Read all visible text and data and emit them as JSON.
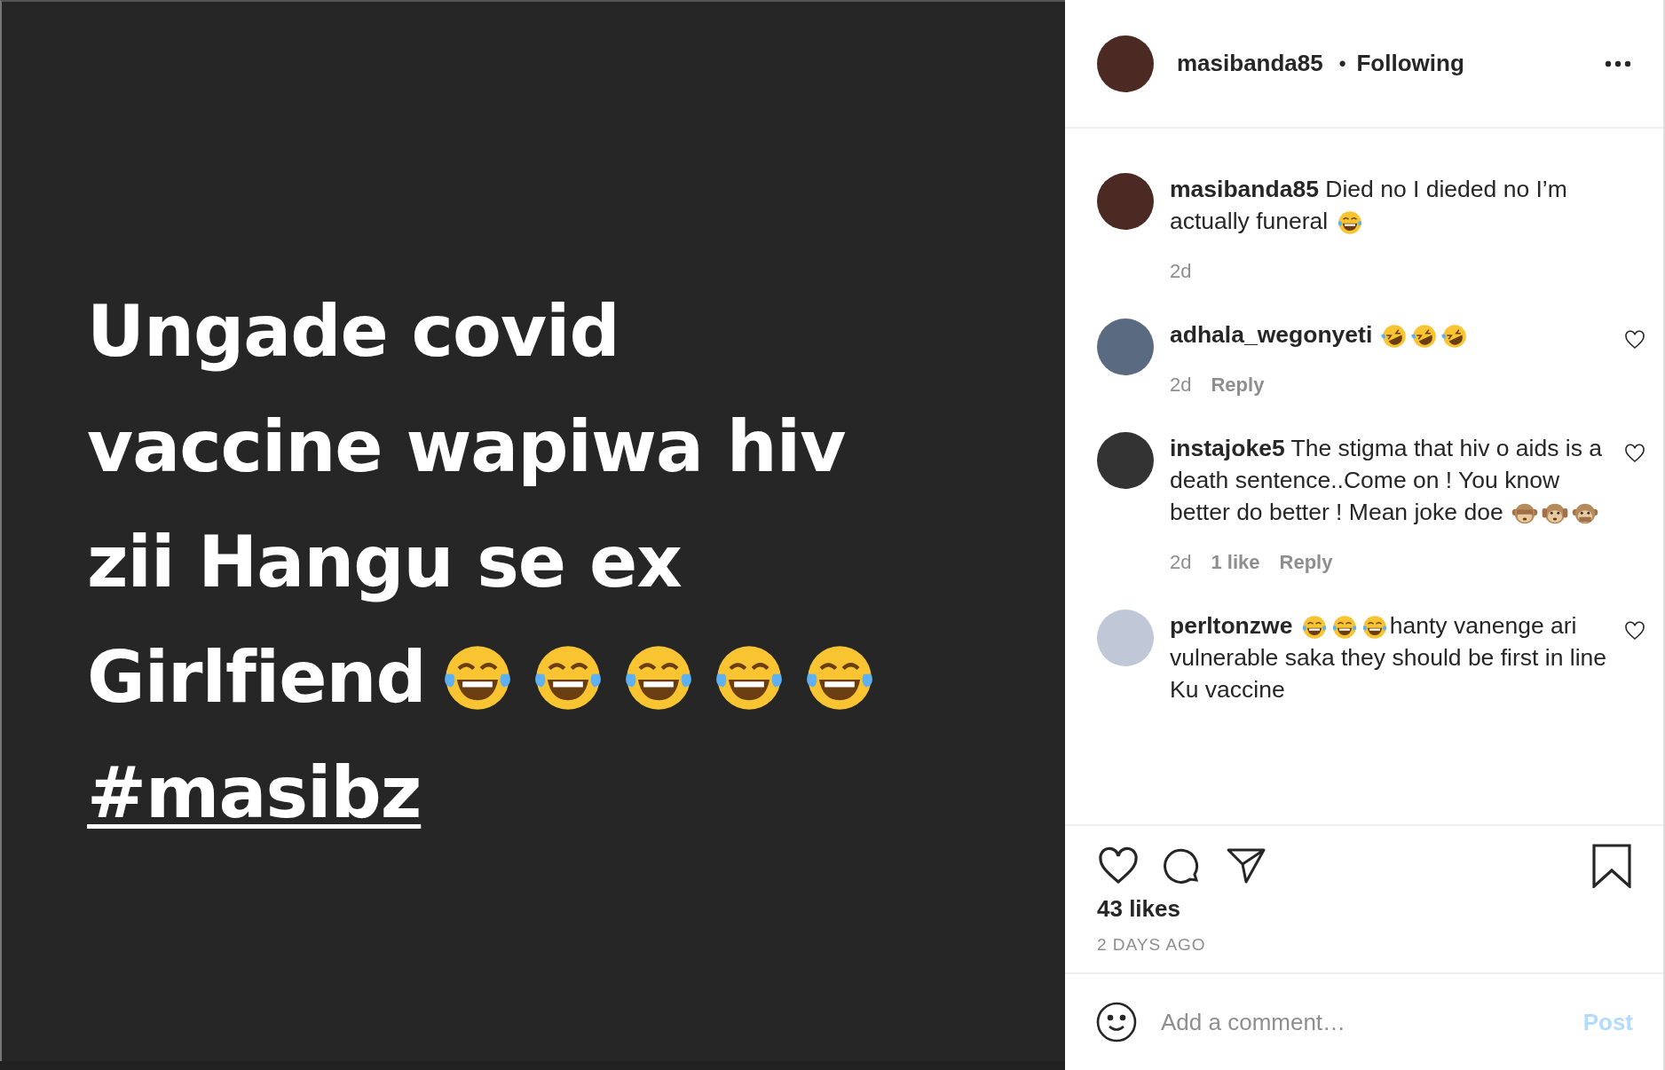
{
  "post_image": {
    "lines": [
      {
        "parts": [
          {
            "kind": "text",
            "text": "Ungade covid"
          }
        ]
      },
      {
        "parts": [
          {
            "kind": "text",
            "text": "vaccine wapiwa hiv"
          }
        ]
      },
      {
        "parts": [
          {
            "kind": "text",
            "text": "zii Hangu se ex"
          }
        ]
      },
      {
        "parts": [
          {
            "kind": "text",
            "text": "Girlfiend"
          },
          {
            "kind": "laugh"
          },
          {
            "kind": "laugh"
          },
          {
            "kind": "laugh"
          },
          {
            "kind": "laugh"
          },
          {
            "kind": "laugh"
          }
        ]
      }
    ],
    "hashtag": "#masibz"
  },
  "header": {
    "username": "masibanda85",
    "separator": "•",
    "follow": "Following"
  },
  "comments": [
    {
      "username": "masibanda85",
      "parts": [
        {
          "kind": "text",
          "text": "Died no I dieded no I’m actually funeral "
        },
        {
          "kind": "laugh"
        }
      ],
      "time": "2d",
      "kind": "caption"
    },
    {
      "username": "adhala_wegonyeti",
      "parts": [
        {
          "kind": "rofl"
        },
        {
          "kind": "rofl"
        },
        {
          "kind": "rofl"
        }
      ],
      "time": "2d",
      "reply": "Reply",
      "kind": "comment"
    },
    {
      "username": "instajoke5",
      "parts": [
        {
          "kind": "text",
          "text": "The stigma that hiv o aids is a death sentence..Come on ! You know better do better ! Mean joke doe "
        },
        {
          "kind": "see-no-evil"
        },
        {
          "kind": "hear-no-evil"
        },
        {
          "kind": "speak-no-evil"
        }
      ],
      "time": "2d",
      "likes": "1 like",
      "reply": "Reply",
      "kind": "comment"
    },
    {
      "username": "perltonzwe",
      "parts": [
        {
          "kind": "laugh"
        },
        {
          "kind": "laugh"
        },
        {
          "kind": "laugh"
        },
        {
          "kind": "text",
          "text": "hanty vanenge ari vulnerable saka they should be first in line Ku vaccine"
        }
      ],
      "kind": "comment"
    }
  ],
  "likes": "43 likes",
  "date": "2 DAYS AGO",
  "comment_box": {
    "placeholder": "Add a comment…",
    "post": "Post"
  }
}
